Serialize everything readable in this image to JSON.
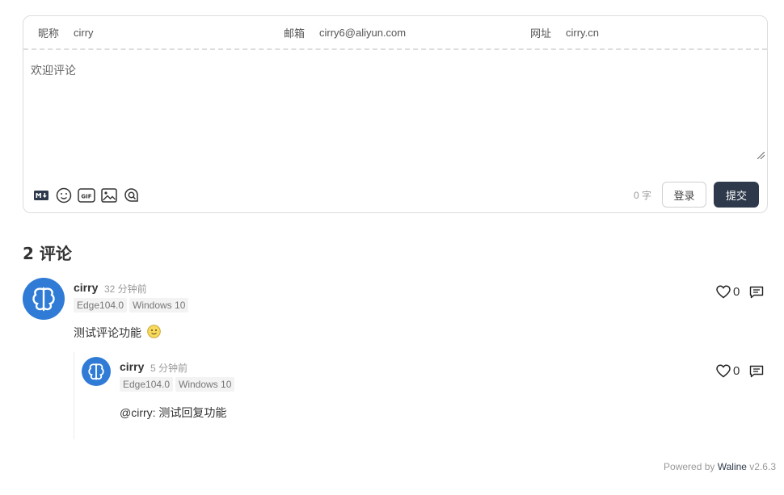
{
  "form": {
    "nick_label": "昵称",
    "nick_value": "cirry",
    "mail_label": "邮箱",
    "mail_value": "cirry6@aliyun.com",
    "link_label": "网址",
    "link_value": "cirry.cn",
    "placeholder": "欢迎评论",
    "word_count": "0",
    "word_unit": "字",
    "login_label": "登录",
    "submit_label": "提交"
  },
  "comments_count": "2 评论",
  "comments": [
    {
      "nick": "cirry",
      "time": "32 分钟前",
      "browser": "Edge104.0",
      "os": "Windows 10",
      "content": "测试评论功能",
      "likes": "0",
      "replies": [
        {
          "nick": "cirry",
          "time": "5 分钟前",
          "browser": "Edge104.0",
          "os": "Windows 10",
          "mention": "@cirry",
          "content": ": 测试回复功能",
          "likes": "0"
        }
      ]
    }
  ],
  "footer": {
    "prefix": "Powered by ",
    "brand": "Waline",
    "version": " v2.6.3"
  }
}
